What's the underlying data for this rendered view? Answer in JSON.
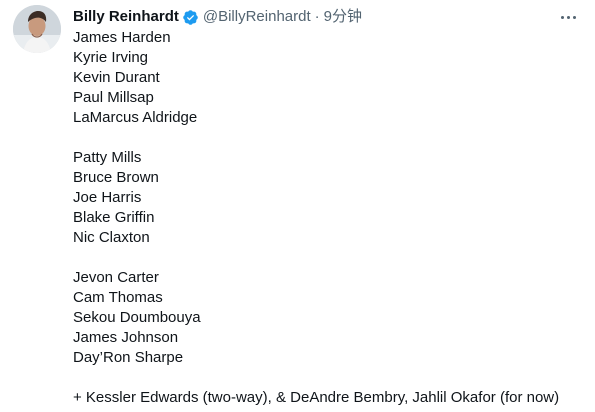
{
  "author": {
    "display_name": "Billy Reinhardt",
    "handle": "@BillyReinhardt",
    "separator": "·",
    "time": "9分钟",
    "avatar_icon": "user-photo",
    "verified_icon": "verified-badge-icon",
    "verified_color": "#1d9bf0"
  },
  "more_icon": "more-options-icon",
  "tweet": {
    "groups": [
      [
        "James Harden",
        "Kyrie Irving",
        "Kevin Durant",
        "Paul Millsap",
        "LaMarcus Aldridge"
      ],
      [
        "Patty Mills",
        "Bruce Brown",
        "Joe Harris",
        "Blake Griffin",
        "Nic Claxton"
      ],
      [
        "Jevon Carter",
        "Cam Thomas",
        "Sekou Doumbouya",
        "James Johnson",
        "Day’Ron Sharpe"
      ],
      [
        "+ Kessler Edwards (two-way), & DeAndre Bembry, Jahlil Okafor (for now)"
      ]
    ]
  }
}
